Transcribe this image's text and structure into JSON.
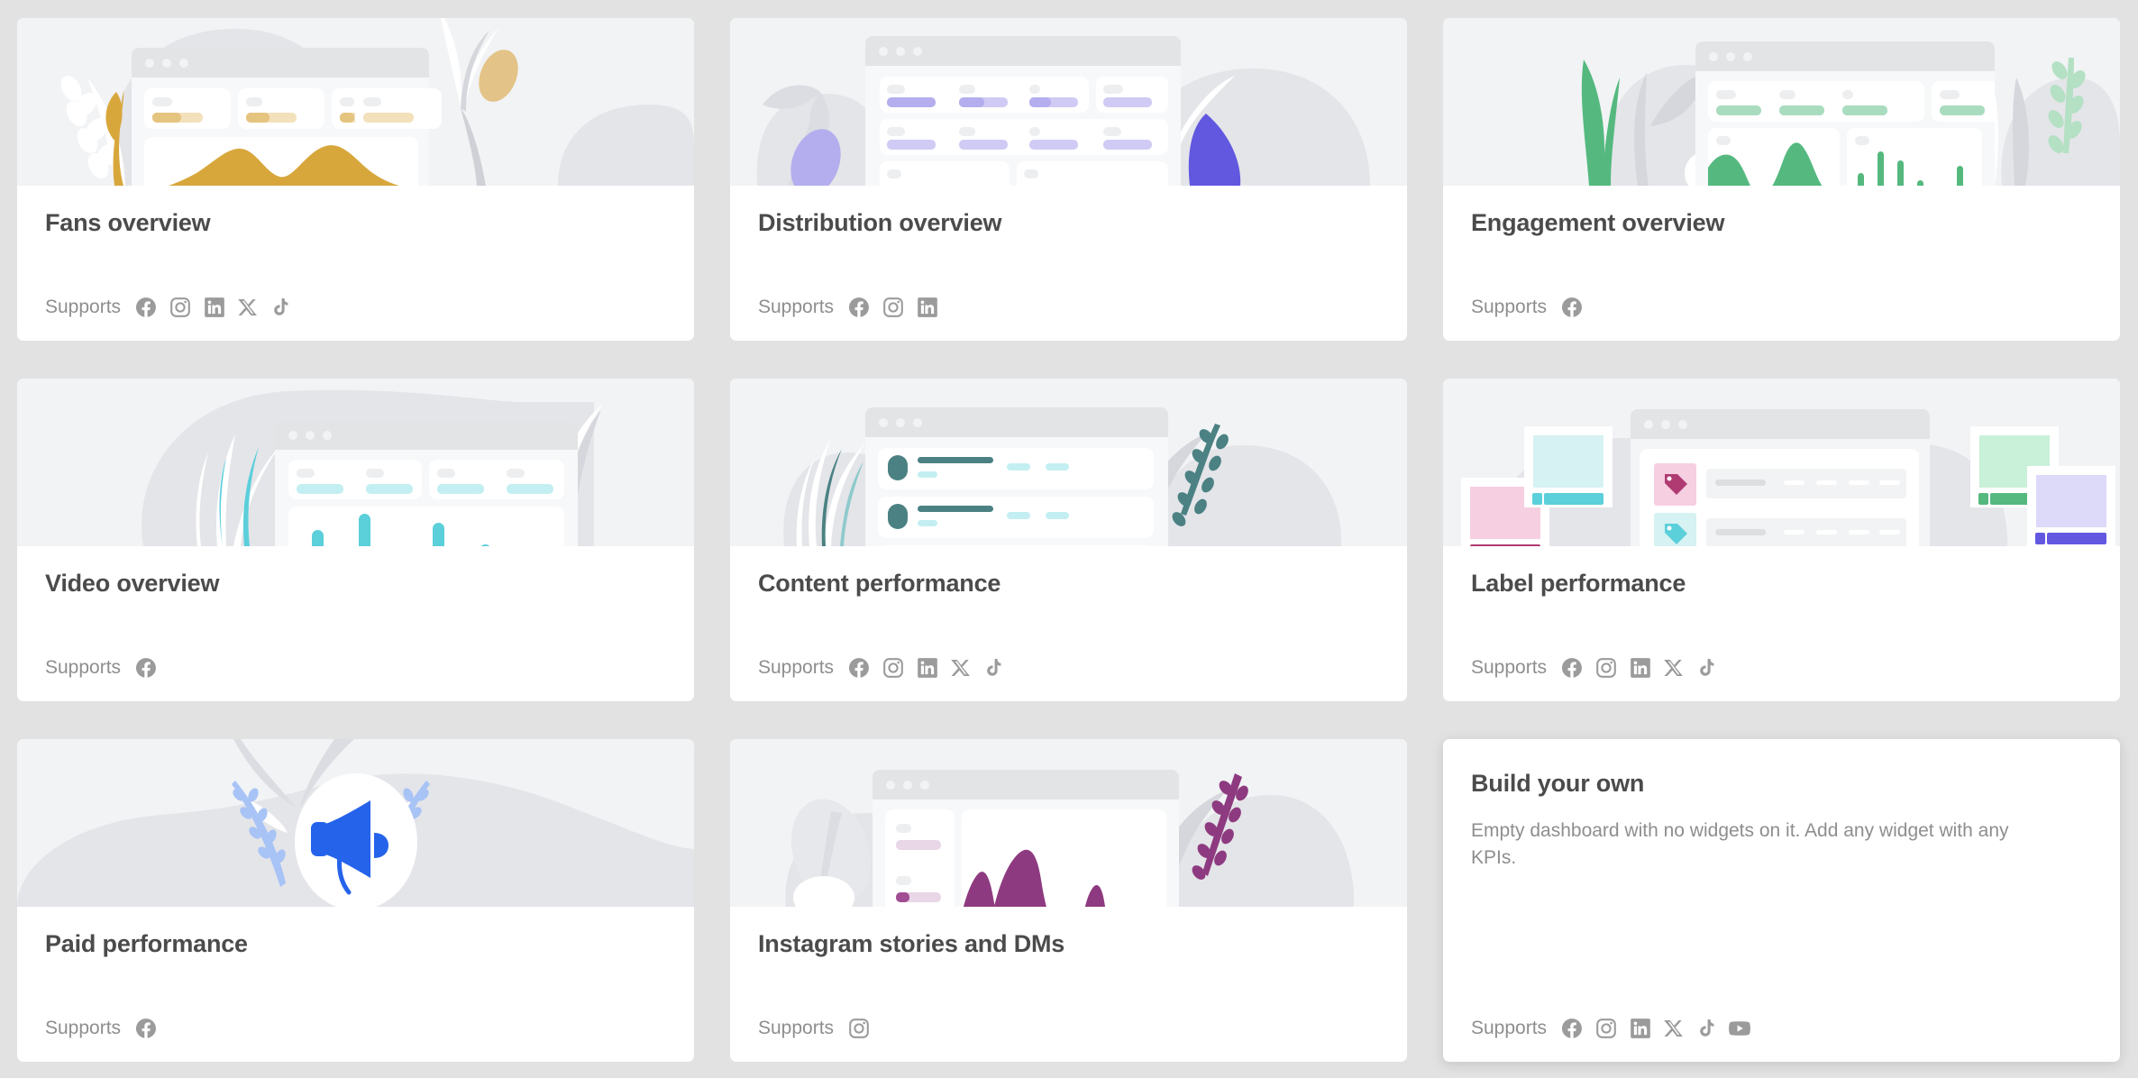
{
  "page": {
    "background_color": "#e2e2e3",
    "supports_label": "Supports"
  },
  "platform_icons": {
    "facebook": "facebook-icon",
    "instagram": "instagram-icon",
    "linkedin": "linkedin-icon",
    "x": "x-twitter-icon",
    "tiktok": "tiktok-icon",
    "youtube": "youtube-icon"
  },
  "cards": [
    {
      "id": "fans-overview",
      "title": "Fans overview",
      "supports_label": "Supports",
      "supports": [
        "facebook",
        "instagram",
        "linkedin",
        "x",
        "tiktok"
      ],
      "accent_color": "#d8a73c",
      "has_thumbnail": true,
      "description": ""
    },
    {
      "id": "distribution-overview",
      "title": "Distribution overview",
      "supports_label": "Supports",
      "supports": [
        "facebook",
        "instagram",
        "linkedin"
      ],
      "accent_color": "#6258e0",
      "has_thumbnail": true,
      "description": ""
    },
    {
      "id": "engagement-overview",
      "title": "Engagement overview",
      "supports_label": "Supports",
      "supports": [
        "facebook"
      ],
      "accent_color": "#55b97f",
      "has_thumbnail": true,
      "description": ""
    },
    {
      "id": "video-overview",
      "title": "Video overview",
      "supports_label": "Supports",
      "supports": [
        "facebook"
      ],
      "accent_color": "#5bcfda",
      "has_thumbnail": true,
      "description": ""
    },
    {
      "id": "content-performance",
      "title": "Content performance",
      "supports_label": "Supports",
      "supports": [
        "facebook",
        "instagram",
        "linkedin",
        "x",
        "tiktok"
      ],
      "accent_color": "#4b8183",
      "has_thumbnail": true,
      "description": ""
    },
    {
      "id": "label-performance",
      "title": "Label performance",
      "supports_label": "Supports",
      "supports": [
        "facebook",
        "instagram",
        "linkedin",
        "x",
        "tiktok"
      ],
      "accent_color": "#b03b73",
      "has_thumbnail": true,
      "description": ""
    },
    {
      "id": "paid-performance",
      "title": "Paid performance",
      "supports_label": "Supports",
      "supports": [
        "facebook"
      ],
      "accent_color": "#2563eb",
      "has_thumbnail": true,
      "description": ""
    },
    {
      "id": "instagram-stories-and-dms",
      "title": "Instagram stories and DMs",
      "supports_label": "Supports",
      "supports": [
        "instagram"
      ],
      "accent_color": "#8e3a80",
      "has_thumbnail": true,
      "description": ""
    },
    {
      "id": "build-your-own",
      "title": "Build your own",
      "supports_label": "Supports",
      "supports": [
        "facebook",
        "instagram",
        "linkedin",
        "x",
        "tiktok",
        "youtube"
      ],
      "accent_color": "#9b9b9b",
      "has_thumbnail": false,
      "description": "Empty dashboard with no widgets on it. Add any widget with any KPIs."
    }
  ]
}
